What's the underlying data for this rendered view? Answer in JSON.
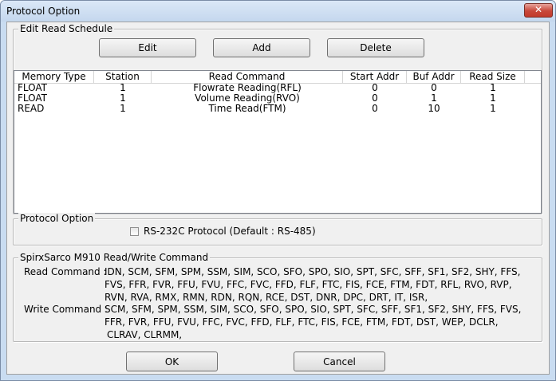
{
  "window": {
    "title": "Protocol Option"
  },
  "edit_schedule": {
    "label": "Edit Read Schedule",
    "buttons": {
      "edit": "Edit",
      "add": "Add",
      "delete": "Delete"
    },
    "columns": [
      "Memory Type",
      "Station",
      "Read Command",
      "Start Addr",
      "Buf Addr",
      "Read Size"
    ],
    "rows": [
      [
        "FLOAT",
        "1",
        "Flowrate Reading(RFL)",
        "0",
        "0",
        "1"
      ],
      [
        "FLOAT",
        "1",
        "Volume Reading(RVO)",
        "0",
        "1",
        "1"
      ],
      [
        "READ",
        "1",
        "Time Read(FTM)",
        "0",
        "10",
        "1"
      ]
    ]
  },
  "protocol_option": {
    "label": "Protocol Option",
    "checkbox_label": "RS-232C Protocol (Default : RS-485)",
    "checked": false
  },
  "commands": {
    "label": "SpirxSarco M910 Read/Write Command",
    "read_label": "Read Command :",
    "read_lines": [
      "IDN, SCM, SFM, SPM, SSM, SIM, SCO, SFO, SPO, SIO, SPT, SFC, SFF, SF1, SF2, SHY, FFS,",
      "FVS, FFR, FVR, FFU, FVU, FFC, FVC, FFD, FLF, FTC, FIS, FCE, FTM, FDT, RFL, RVO, RVP,",
      "RVN, RVA, RMX, RMN, RDN, RQN, RCE, DST, DNR, DPC, DRT, IT, ISR,"
    ],
    "write_label": "Write Command :",
    "write_lines": [
      "SCM, SFM, SPM, SSM, SIM, SCO, SFO, SPO, SIO, SPT, SFC, SFF, SF1, SF2, SHY, FFS, FVS,",
      "FFR, FVR, FFU, FVU, FFC, FVC, FFD, FLF, FTC, FIS, FCE, FTM, FDT, DST, WEP, DCLR,",
      "CLRAV, CLRMM,"
    ]
  },
  "footer": {
    "ok": "OK",
    "cancel": "Cancel"
  },
  "icons": {
    "close": "close-icon"
  }
}
